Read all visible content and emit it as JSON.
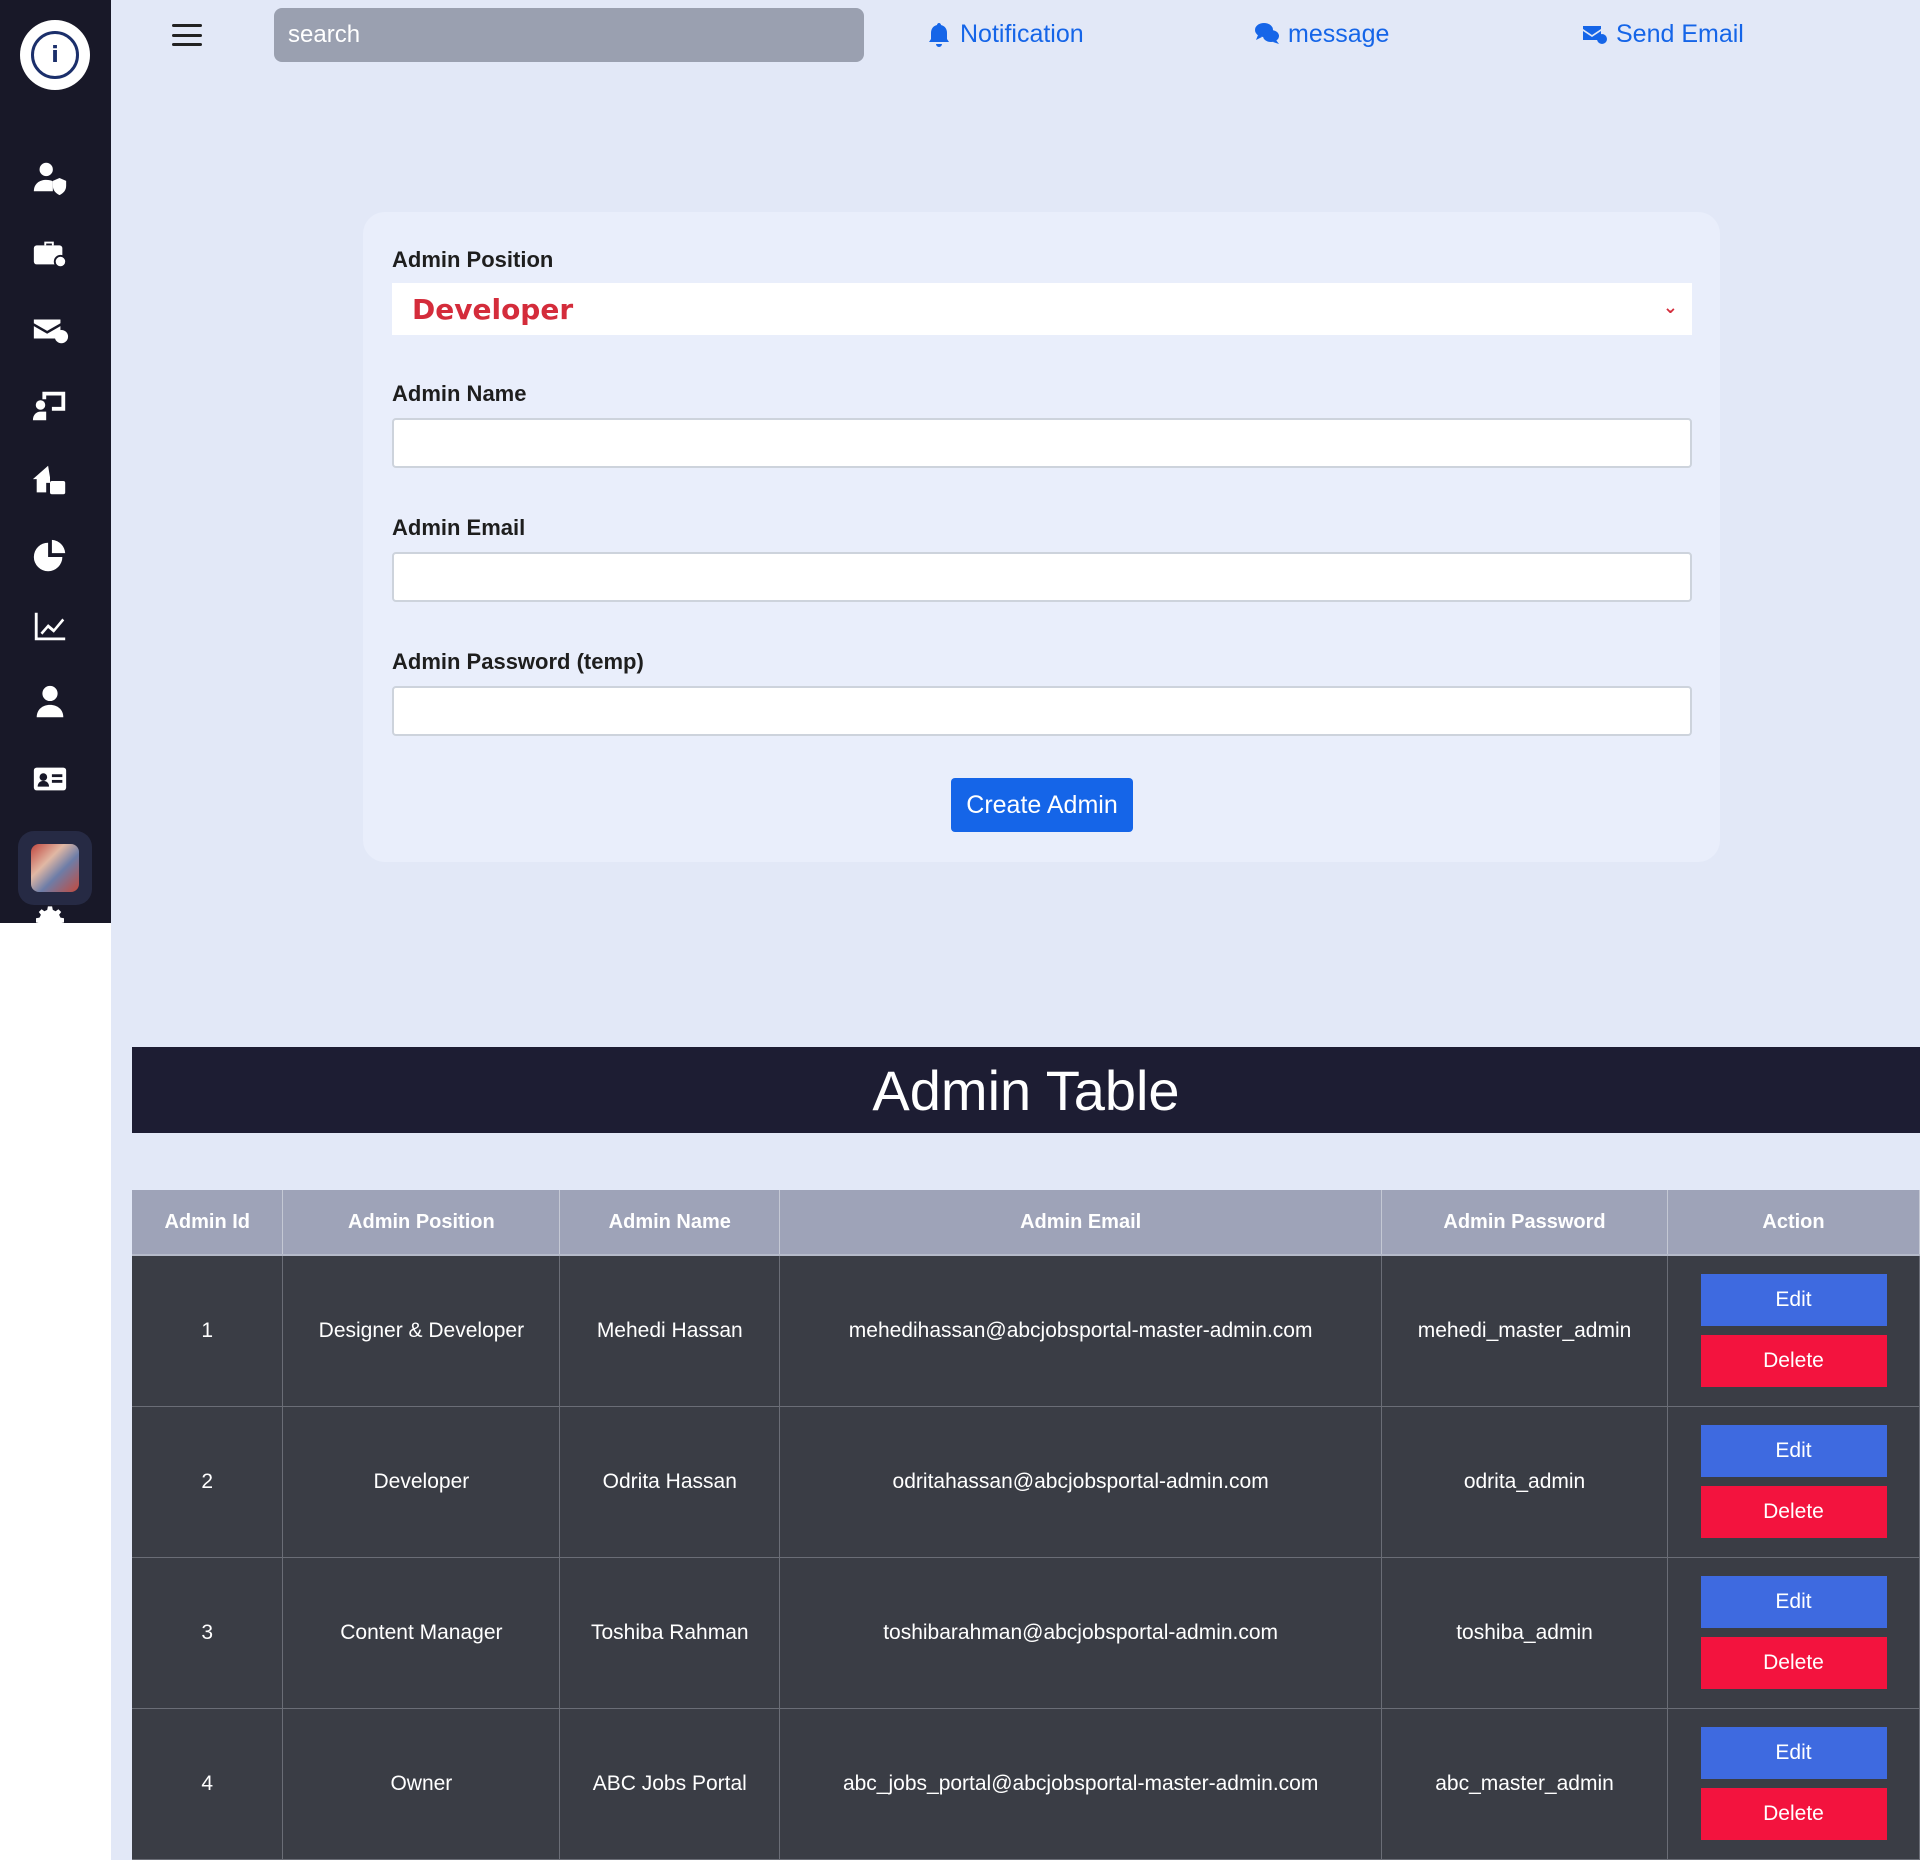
{
  "topbar": {
    "search_placeholder": "search",
    "notification_label": "Notification",
    "message_label": "message",
    "send_email_label": "Send Email"
  },
  "sidebar": {
    "logo_text": "i",
    "icons": [
      "user-shield-icon",
      "briefcase-icon",
      "mail-check-icon",
      "presentation-icon",
      "house-transfer-icon",
      "pie-chart-icon",
      "line-chart-icon",
      "user-tie-icon",
      "id-card-icon",
      "gear-icon"
    ]
  },
  "form": {
    "position_label": "Admin Position",
    "position_value": "Developer",
    "name_label": "Admin Name",
    "email_label": "Admin Email",
    "password_label": "Admin Password (temp)",
    "submit_label": "Create Admin"
  },
  "table": {
    "title": "Admin Table",
    "headers": [
      "Admin Id",
      "Admin Position",
      "Admin Name",
      "Admin Email",
      "Admin Password",
      "Action"
    ],
    "rows": [
      {
        "id": "1",
        "position": "Designer & Developer",
        "name": "Mehedi Hassan",
        "email": "mehedihassan@abcjobsportal-master-admin.com",
        "password": "mehedi_master_admin"
      },
      {
        "id": "2",
        "position": "Developer",
        "name": "Odrita Hassan",
        "email": "odritahassan@abcjobsportal-admin.com",
        "password": "odrita_admin"
      },
      {
        "id": "3",
        "position": "Content Manager",
        "name": "Toshiba Rahman",
        "email": "toshibarahman@abcjobsportal-admin.com",
        "password": "toshiba_admin"
      },
      {
        "id": "4",
        "position": "Owner",
        "name": "ABC Jobs Portal",
        "email": "abc_jobs_portal@abcjobsportal-master-admin.com",
        "password": "abc_master_admin"
      }
    ],
    "edit_label": "Edit",
    "delete_label": "Delete"
  },
  "colors": {
    "accent": "#1565e8",
    "danger": "#f3133e",
    "edit": "#3e6ae0",
    "sidebar_bg": "#181828",
    "select_text": "#d42c3b"
  }
}
